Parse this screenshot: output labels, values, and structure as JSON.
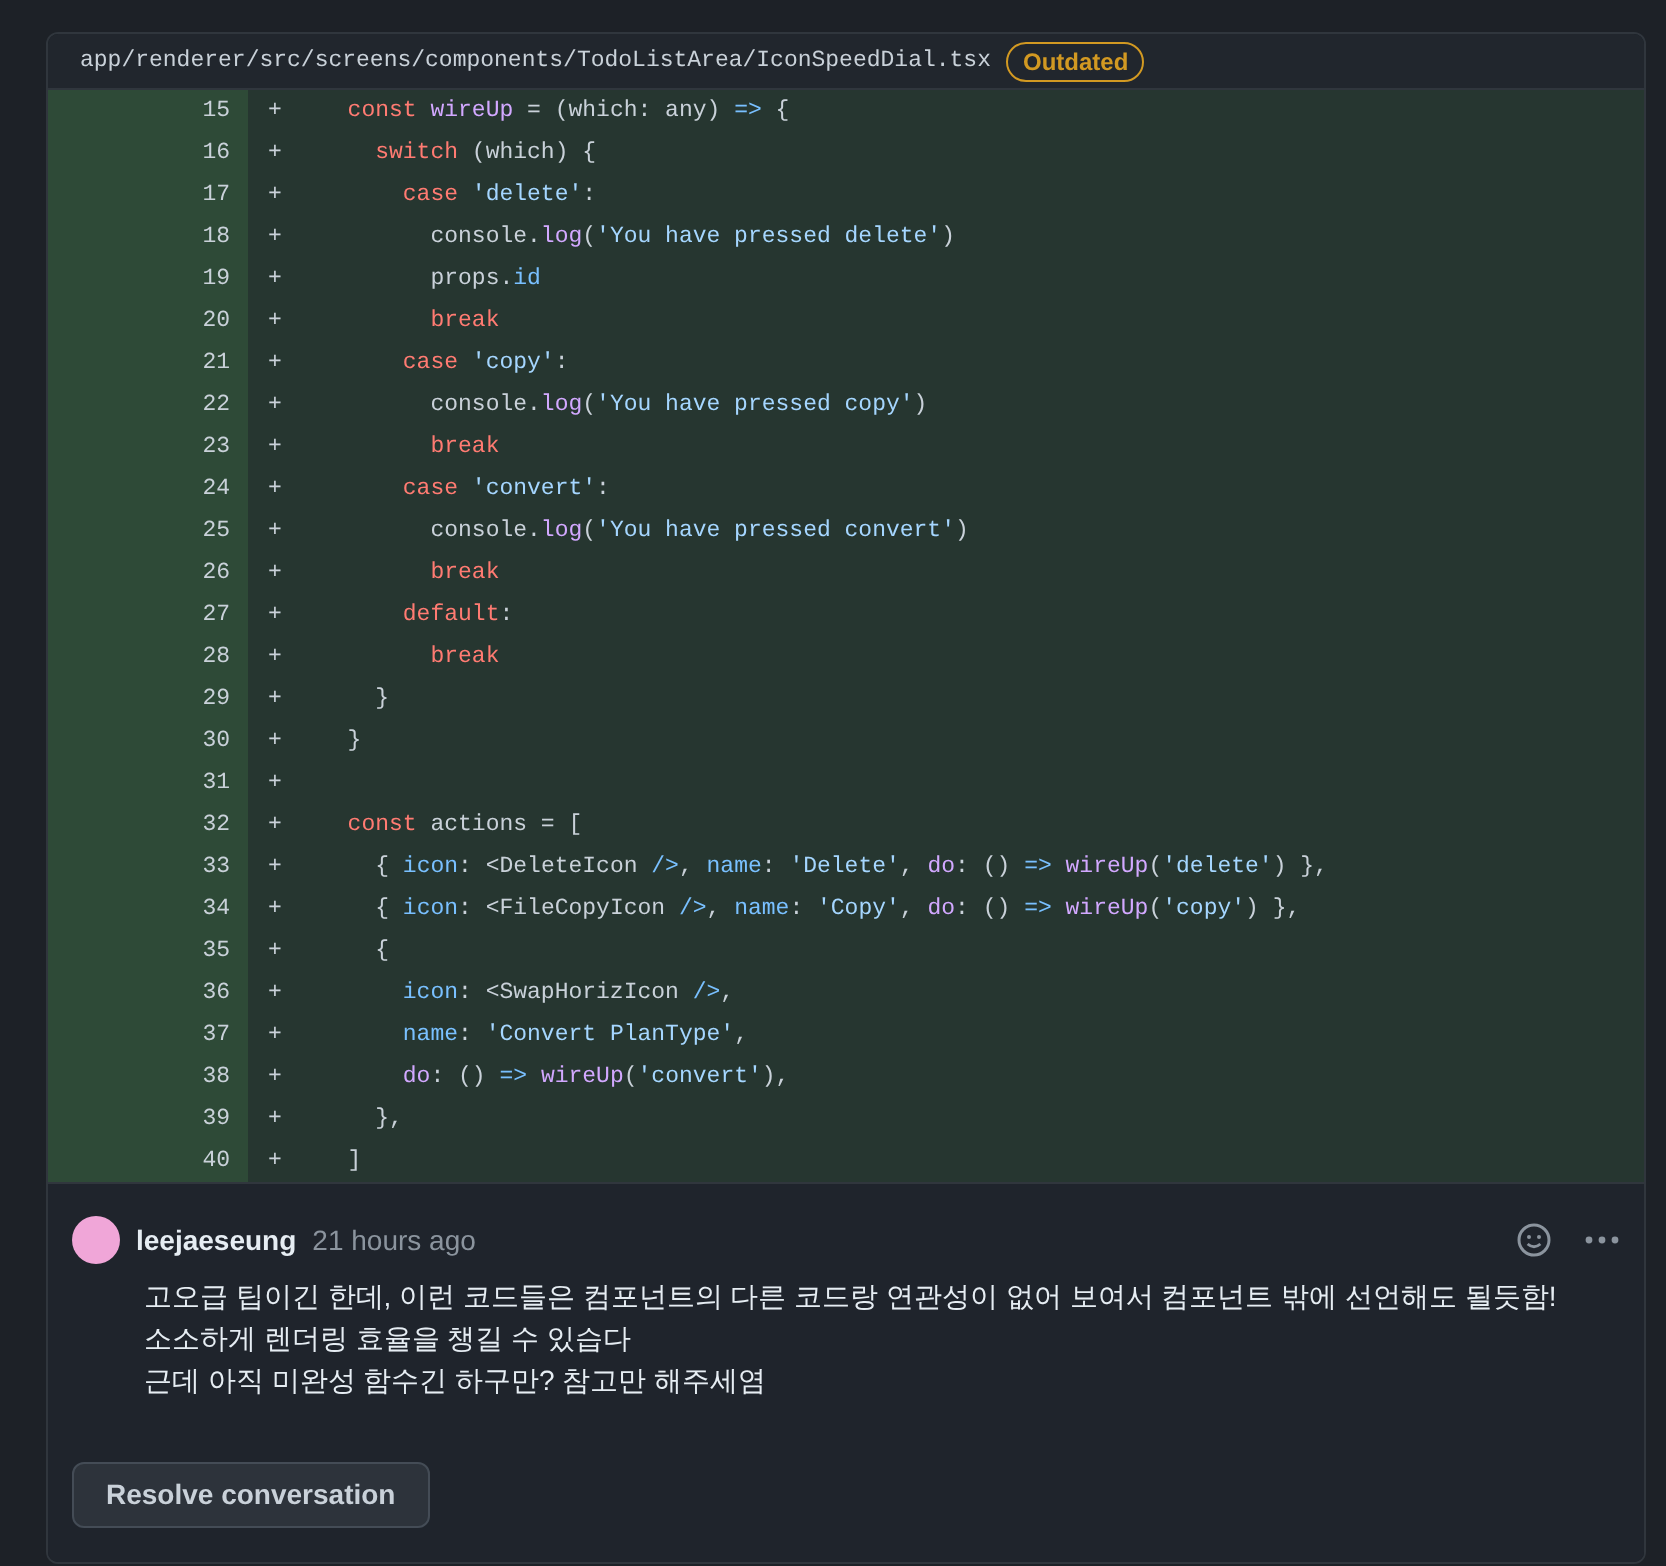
{
  "file_header": {
    "path": "app/renderer/src/screens/components/TodoListArea/IconSpeedDial.tsx",
    "badge": "Outdated"
  },
  "diff_lines": [
    {
      "number": "15",
      "marker": "+",
      "tokens": [
        {
          "kind": "kw",
          "text": "  const "
        },
        {
          "kind": "fn",
          "text": "wireUp"
        },
        {
          "kind": "plain",
          "text": " = (which: any) "
        },
        {
          "kind": "prop",
          "text": "=>"
        },
        {
          "kind": "plain",
          "text": " {"
        }
      ]
    },
    {
      "number": "16",
      "marker": "+",
      "tokens": [
        {
          "kind": "kw",
          "text": "    switch"
        },
        {
          "kind": "plain",
          "text": " (which) {"
        }
      ]
    },
    {
      "number": "17",
      "marker": "+",
      "tokens": [
        {
          "kind": "kw",
          "text": "      case "
        },
        {
          "kind": "str",
          "text": "'delete'"
        },
        {
          "kind": "plain",
          "text": ":"
        }
      ]
    },
    {
      "number": "18",
      "marker": "+",
      "tokens": [
        {
          "kind": "plain",
          "text": "        console."
        },
        {
          "kind": "fn",
          "text": "log"
        },
        {
          "kind": "plain",
          "text": "("
        },
        {
          "kind": "str",
          "text": "'You have pressed delete'"
        },
        {
          "kind": "plain",
          "text": ")"
        }
      ]
    },
    {
      "number": "19",
      "marker": "+",
      "tokens": [
        {
          "kind": "plain",
          "text": "        props."
        },
        {
          "kind": "prop",
          "text": "id"
        }
      ]
    },
    {
      "number": "20",
      "marker": "+",
      "tokens": [
        {
          "kind": "kw",
          "text": "        break"
        }
      ]
    },
    {
      "number": "21",
      "marker": "+",
      "tokens": [
        {
          "kind": "kw",
          "text": "      case "
        },
        {
          "kind": "str",
          "text": "'copy'"
        },
        {
          "kind": "plain",
          "text": ":"
        }
      ]
    },
    {
      "number": "22",
      "marker": "+",
      "tokens": [
        {
          "kind": "plain",
          "text": "        console."
        },
        {
          "kind": "fn",
          "text": "log"
        },
        {
          "kind": "plain",
          "text": "("
        },
        {
          "kind": "str",
          "text": "'You have pressed copy'"
        },
        {
          "kind": "plain",
          "text": ")"
        }
      ]
    },
    {
      "number": "23",
      "marker": "+",
      "tokens": [
        {
          "kind": "kw",
          "text": "        break"
        }
      ]
    },
    {
      "number": "24",
      "marker": "+",
      "tokens": [
        {
          "kind": "kw",
          "text": "      case "
        },
        {
          "kind": "str",
          "text": "'convert'"
        },
        {
          "kind": "plain",
          "text": ":"
        }
      ]
    },
    {
      "number": "25",
      "marker": "+",
      "tokens": [
        {
          "kind": "plain",
          "text": "        console."
        },
        {
          "kind": "fn",
          "text": "log"
        },
        {
          "kind": "plain",
          "text": "("
        },
        {
          "kind": "str",
          "text": "'You have pressed convert'"
        },
        {
          "kind": "plain",
          "text": ")"
        }
      ]
    },
    {
      "number": "26",
      "marker": "+",
      "tokens": [
        {
          "kind": "kw",
          "text": "        break"
        }
      ]
    },
    {
      "number": "27",
      "marker": "+",
      "tokens": [
        {
          "kind": "kw",
          "text": "      default"
        },
        {
          "kind": "plain",
          "text": ":"
        }
      ]
    },
    {
      "number": "28",
      "marker": "+",
      "tokens": [
        {
          "kind": "kw",
          "text": "        break"
        }
      ]
    },
    {
      "number": "29",
      "marker": "+",
      "tokens": [
        {
          "kind": "plain",
          "text": "    }"
        }
      ]
    },
    {
      "number": "30",
      "marker": "+",
      "tokens": [
        {
          "kind": "plain",
          "text": "  }"
        }
      ]
    },
    {
      "number": "31",
      "marker": "+"
    },
    {
      "number": "32",
      "marker": "+",
      "tokens": [
        {
          "kind": "kw",
          "text": "  const "
        },
        {
          "kind": "plain",
          "text": "actions = ["
        }
      ]
    },
    {
      "number": "33",
      "marker": "+",
      "tokens": [
        {
          "kind": "plain",
          "text": "    { "
        },
        {
          "kind": "prop",
          "text": "icon"
        },
        {
          "kind": "plain",
          "text": ": <DeleteIcon "
        },
        {
          "kind": "prop",
          "text": "/>"
        },
        {
          "kind": "plain",
          "text": ", "
        },
        {
          "kind": "prop",
          "text": "name"
        },
        {
          "kind": "plain",
          "text": ": "
        },
        {
          "kind": "str",
          "text": "'Delete'"
        },
        {
          "kind": "plain",
          "text": ", "
        },
        {
          "kind": "fn",
          "text": "do"
        },
        {
          "kind": "plain",
          "text": ": () "
        },
        {
          "kind": "prop",
          "text": "=> "
        },
        {
          "kind": "fn",
          "text": "wireUp"
        },
        {
          "kind": "plain",
          "text": "("
        },
        {
          "kind": "str",
          "text": "'delete'"
        },
        {
          "kind": "plain",
          "text": ") },"
        }
      ]
    },
    {
      "number": "34",
      "marker": "+",
      "tokens": [
        {
          "kind": "plain",
          "text": "    { "
        },
        {
          "kind": "prop",
          "text": "icon"
        },
        {
          "kind": "plain",
          "text": ": <FileCopyIcon "
        },
        {
          "kind": "prop",
          "text": "/>"
        },
        {
          "kind": "plain",
          "text": ", "
        },
        {
          "kind": "prop",
          "text": "name"
        },
        {
          "kind": "plain",
          "text": ": "
        },
        {
          "kind": "str",
          "text": "'Copy'"
        },
        {
          "kind": "plain",
          "text": ", "
        },
        {
          "kind": "fn",
          "text": "do"
        },
        {
          "kind": "plain",
          "text": ": () "
        },
        {
          "kind": "prop",
          "text": "=> "
        },
        {
          "kind": "fn",
          "text": "wireUp"
        },
        {
          "kind": "plain",
          "text": "("
        },
        {
          "kind": "str",
          "text": "'copy'"
        },
        {
          "kind": "plain",
          "text": ") },"
        }
      ]
    },
    {
      "number": "35",
      "marker": "+",
      "tokens": [
        {
          "kind": "plain",
          "text": "    {"
        }
      ]
    },
    {
      "number": "36",
      "marker": "+",
      "tokens": [
        {
          "kind": "prop",
          "text": "      icon"
        },
        {
          "kind": "plain",
          "text": ": <SwapHorizIcon "
        },
        {
          "kind": "prop",
          "text": "/>"
        },
        {
          "kind": "plain",
          "text": ","
        }
      ]
    },
    {
      "number": "37",
      "marker": "+",
      "tokens": [
        {
          "kind": "prop",
          "text": "      name"
        },
        {
          "kind": "plain",
          "text": ": "
        },
        {
          "kind": "str",
          "text": "'Convert PlanType'"
        },
        {
          "kind": "plain",
          "text": ","
        }
      ]
    },
    {
      "number": "38",
      "marker": "+",
      "tokens": [
        {
          "kind": "fn",
          "text": "      do"
        },
        {
          "kind": "plain",
          "text": ": () "
        },
        {
          "kind": "prop",
          "text": "=> "
        },
        {
          "kind": "fn",
          "text": "wireUp"
        },
        {
          "kind": "plain",
          "text": "("
        },
        {
          "kind": "str",
          "text": "'convert'"
        },
        {
          "kind": "plain",
          "text": "),"
        }
      ]
    },
    {
      "number": "39",
      "marker": "+",
      "tokens": [
        {
          "kind": "plain",
          "text": "    },"
        }
      ]
    },
    {
      "number": "40",
      "marker": "+",
      "tokens": [
        {
          "kind": "plain",
          "text": "  ]"
        }
      ]
    }
  ],
  "comment": {
    "author": "leejaeseung",
    "time": "21 hours ago",
    "body": [
      "고오급 팁이긴 한데, 이런 코드들은 컴포넌트의 다른 코드랑 연관성이 없어 보여서 컴포넌트 밖에 선언해도 될듯함!",
      "소소하게 렌더링 효율을 챙길 수 있습다",
      "근데 아직 미완성 함수긴 하구만? 참고만 해주세염"
    ]
  },
  "resolve_button": "Resolve conversation"
}
